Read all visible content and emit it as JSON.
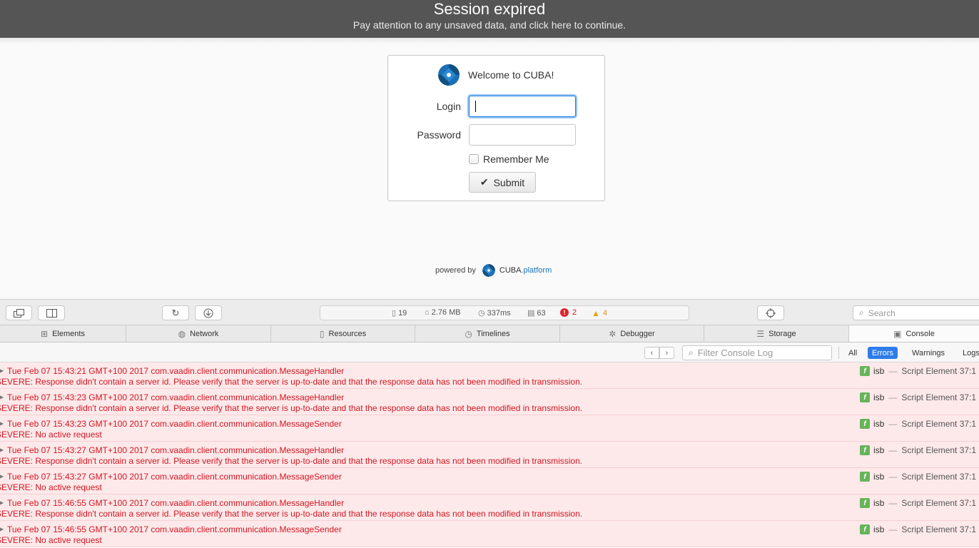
{
  "banner": {
    "title": "Session expired",
    "message": "Pay attention to any unsaved data, and click here to continue."
  },
  "login": {
    "welcome": "Welcome to CUBA!",
    "login_label": "Login",
    "login_value": "",
    "password_label": "Password",
    "password_value": "",
    "remember_label": "Remember Me",
    "remember_checked": false,
    "submit_label": "Submit"
  },
  "footer": {
    "powered_by": "powered by",
    "brand_cuba": "CUBA",
    "brand_platform": ".platform"
  },
  "devtools": {
    "stats": {
      "resources": "19",
      "size": "2.76 MB",
      "time": "337ms",
      "messages": "63",
      "errors": "2",
      "warnings": "4"
    },
    "search_placeholder": "Search",
    "tabs": [
      {
        "label": "Elements",
        "icon": "elements-icon"
      },
      {
        "label": "Network",
        "icon": "network-icon"
      },
      {
        "label": "Resources",
        "icon": "resources-icon"
      },
      {
        "label": "Timelines",
        "icon": "timelines-icon"
      },
      {
        "label": "Debugger",
        "icon": "debugger-icon"
      },
      {
        "label": "Storage",
        "icon": "storage-icon"
      },
      {
        "label": "Console",
        "icon": "console-icon",
        "active": true
      }
    ],
    "filter_placeholder": "Filter Console Log",
    "filters": {
      "all": "All",
      "errors": "Errors",
      "warnings": "Warnings",
      "logs": "Logs"
    },
    "entries": [
      {
        "line1": "Tue Feb 07 15:43:21 GMT+100 2017 com.vaadin.client.communication.MessageHandler",
        "line2": "SEVERE: Response didn't contain a server id. Please verify that the server is up-to-date and that the response data has not been modified in transmission.",
        "source": "isb",
        "location": "Script Element 37:1"
      },
      {
        "line1": "Tue Feb 07 15:43:23 GMT+100 2017 com.vaadin.client.communication.MessageHandler",
        "line2": "SEVERE: Response didn't contain a server id. Please verify that the server is up-to-date and that the response data has not been modified in transmission.",
        "source": "isb",
        "location": "Script Element 37:1"
      },
      {
        "line1": "Tue Feb 07 15:43:23 GMT+100 2017 com.vaadin.client.communication.MessageSender",
        "line2": "SEVERE: No active request",
        "source": "isb",
        "location": "Script Element 37:1"
      },
      {
        "line1": "Tue Feb 07 15:43:27 GMT+100 2017 com.vaadin.client.communication.MessageHandler",
        "line2": "SEVERE: Response didn't contain a server id. Please verify that the server is up-to-date and that the response data has not been modified in transmission.",
        "source": "isb",
        "location": "Script Element 37:1"
      },
      {
        "line1": "Tue Feb 07 15:43:27 GMT+100 2017 com.vaadin.client.communication.MessageSender",
        "line2": "SEVERE: No active request",
        "source": "isb",
        "location": "Script Element 37:1"
      },
      {
        "line1": "Tue Feb 07 15:46:55 GMT+100 2017 com.vaadin.client.communication.MessageHandler",
        "line2": "SEVERE: Response didn't contain a server id. Please verify that the server is up-to-date and that the response data has not been modified in transmission.",
        "source": "isb",
        "location": "Script Element 37:1"
      },
      {
        "line1": "Tue Feb 07 15:46:55 GMT+100 2017 com.vaadin.client.communication.MessageSender",
        "line2": "SEVERE: No active request",
        "source": "isb",
        "location": "Script Element 37:1"
      }
    ]
  }
}
